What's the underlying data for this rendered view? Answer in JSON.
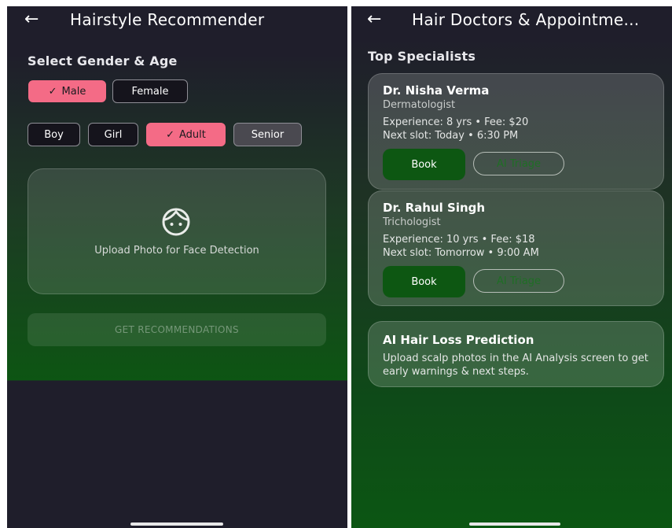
{
  "left": {
    "back_icon": "arrow-left-icon",
    "title": "Hairstyle Recommender",
    "section_title": "Select Gender & Age",
    "gender_options": [
      {
        "label": "Male",
        "selected": true
      },
      {
        "label": "Female",
        "selected": false
      }
    ],
    "age_options": [
      {
        "label": "Boy",
        "selected": false
      },
      {
        "label": "Girl",
        "selected": false
      },
      {
        "label": "Adult",
        "selected": true
      },
      {
        "label": "Senior",
        "selected": false
      }
    ],
    "check_glyph": "✓",
    "upload": {
      "icon": "face-icon",
      "label": "Upload Photo for Face Detection"
    },
    "get_recommendations_label": "GET RECOMMENDATIONS"
  },
  "right": {
    "back_icon": "arrow-left-icon",
    "title": "Hair Doctors & Appointme...",
    "section_title": "Top Specialists",
    "doctors": [
      {
        "name": "Dr. Nisha Verma",
        "specialty": "Dermatologist",
        "details": "Experience: 8 yrs • Fee: $20",
        "slot": "Next slot: Today • 6:30 PM",
        "book_label": "Book",
        "triage_label": "AI Triage"
      },
      {
        "name": "Dr. Rahul Singh",
        "specialty": "Trichologist",
        "details": "Experience: 10 yrs • Fee: $18",
        "slot": "Next slot: Tomorrow • 9:00 AM",
        "book_label": "Book",
        "triage_label": "AI Triage"
      }
    ],
    "prediction": {
      "title": "AI Hair Loss Prediction",
      "body": "Upload scalp photos in the AI Analysis screen to get early warnings & next steps."
    }
  },
  "colors": {
    "accent_pink": "#f46b86",
    "book_green": "#0d5712",
    "background_dark": "#1f1e2b"
  }
}
